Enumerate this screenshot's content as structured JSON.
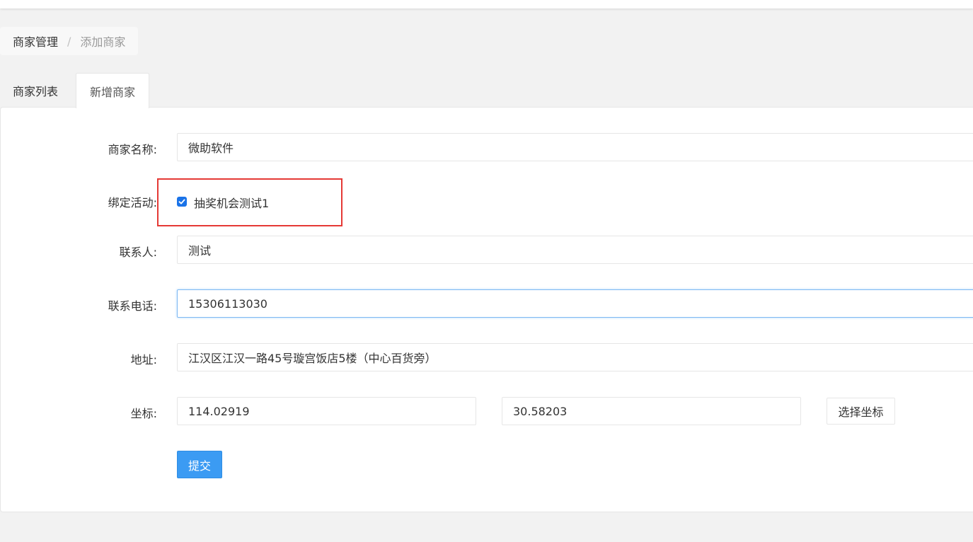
{
  "breadcrumb": {
    "parent": "商家管理",
    "separator": "/",
    "current": "添加商家"
  },
  "tabs": [
    {
      "label": "商家列表",
      "active": false
    },
    {
      "label": "新增商家",
      "active": true
    }
  ],
  "form": {
    "name": {
      "label": "商家名称:",
      "value": "微助软件"
    },
    "activity": {
      "label": "绑定活动:",
      "option": "抽奖机会测试1",
      "checked": true
    },
    "contact": {
      "label": "联系人:",
      "value": "测试"
    },
    "phone": {
      "label": "联系电话:",
      "value": "15306113030"
    },
    "address": {
      "label": "地址:",
      "value": "江汉区江汉一路45号璇宫饭店5楼（中心百货旁）"
    },
    "coords": {
      "label": "坐标:",
      "lng": "114.02919",
      "lat": "30.58203",
      "pick_label": "选择坐标"
    },
    "submit_label": "提交"
  },
  "colors": {
    "primary": "#3b9bf3",
    "highlight": "#e53935",
    "checkbox": "#1a73e8"
  }
}
